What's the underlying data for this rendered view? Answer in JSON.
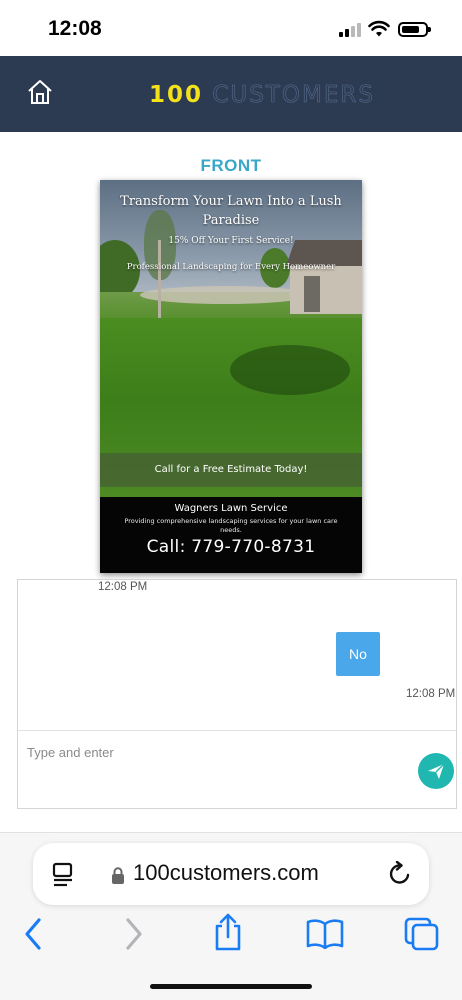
{
  "status_bar": {
    "time": "12:08"
  },
  "header": {
    "brand_number": "100",
    "brand_word": "CUSTOMERS"
  },
  "preview": {
    "section_label": "FRONT",
    "headline": "Transform Your Lawn Into a Lush Paradise",
    "discount": "15% Off Your First Service!",
    "tagline": "Professional Landscaping for Every Homeowner",
    "cta": "Call for a Free Estimate Today!",
    "business_name": "Wagners Lawn Service",
    "business_desc": "Providing comprehensive landscaping services for your lawn care needs.",
    "phone": "Call: 779-770-8731"
  },
  "chat": {
    "messages": [
      {
        "timestamp": "12:08 PM"
      },
      {
        "text": "No",
        "timestamp": "12:08 PM"
      }
    ],
    "input_placeholder": "Type and enter"
  },
  "browser": {
    "url": "100customers.com"
  },
  "colors": {
    "header_bg": "#2c3b52",
    "brand_accent": "#f3e21a",
    "section_label": "#3aa6c8",
    "bubble": "#4aa8ea",
    "send_button": "#20b7b1",
    "ios_blue": "#1a7cf5"
  },
  "icons": [
    "home-icon",
    "reader-mode-icon",
    "lock-icon",
    "reload-icon",
    "back-chevron-icon",
    "forward-chevron-icon",
    "share-icon",
    "bookmarks-icon",
    "tabs-icon",
    "send-icon"
  ]
}
